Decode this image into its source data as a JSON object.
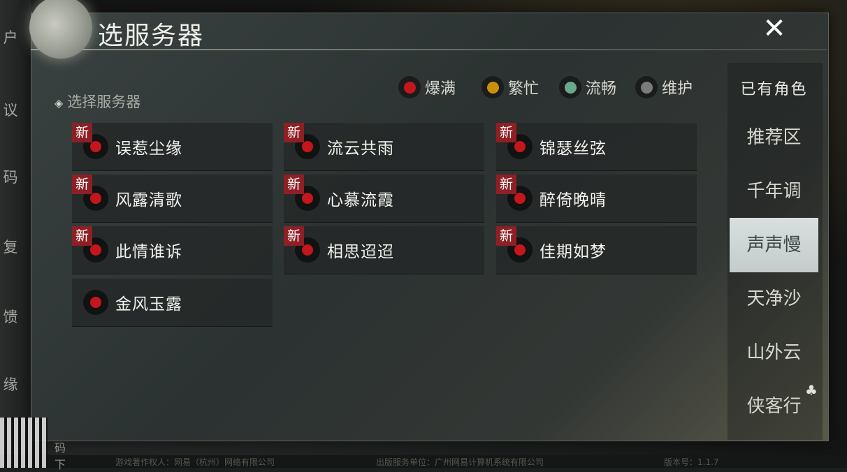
{
  "window": {
    "title": "选服务器",
    "close_glyph": "✕"
  },
  "side_strip": [
    "户",
    "议",
    "码",
    "复",
    "馈",
    "缘"
  ],
  "legend": [
    {
      "label": "爆满",
      "color": "#c4161c"
    },
    {
      "label": "繁忙",
      "color": "#c9900f"
    },
    {
      "label": "流畅",
      "color": "#6aa88d"
    },
    {
      "label": "维护",
      "color": "#7a7a7a"
    }
  ],
  "section": {
    "label": "选择服务器",
    "marker": "◈"
  },
  "servers": [
    {
      "name": "误惹尘缘",
      "new": true
    },
    {
      "name": "流云共雨",
      "new": true
    },
    {
      "name": "锦瑟丝弦",
      "new": true
    },
    {
      "name": "风露清歌",
      "new": true
    },
    {
      "name": "心慕流霞",
      "new": true
    },
    {
      "name": "醉倚晚晴",
      "new": true
    },
    {
      "name": "此情谁诉",
      "new": true
    },
    {
      "name": "相思迢迢",
      "new": true
    },
    {
      "name": "佳期如梦",
      "new": true
    },
    {
      "name": "金风玉露",
      "new": false
    }
  ],
  "new_badge": "新",
  "tabs": [
    {
      "label": "已有角色",
      "active": false
    },
    {
      "label": "推荐区",
      "active": false
    },
    {
      "label": "千年调",
      "active": false
    },
    {
      "label": "声声慢",
      "active": true
    },
    {
      "label": "天净沙",
      "active": false
    },
    {
      "label": "山外云",
      "active": false
    },
    {
      "label": "侠客行",
      "active": false
    }
  ],
  "qr_labels": [
    "码",
    "下"
  ],
  "footer": {
    "publisher": "游戏著作权人：网易（杭州）网络有限公司",
    "service": "出版服务单位：广州网易计算机系统有限公司",
    "version": "版本号：1.1.7"
  }
}
